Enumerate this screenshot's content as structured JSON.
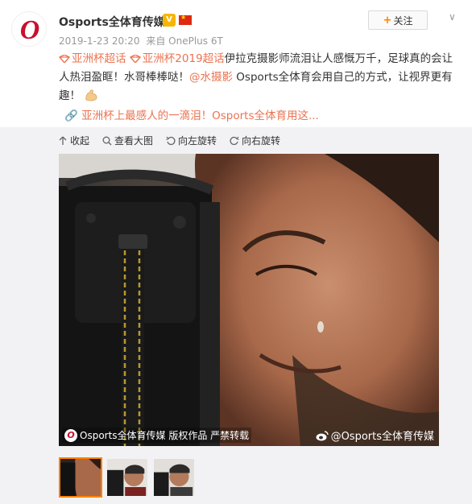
{
  "author": {
    "name": "Osports全体育传媒",
    "avatar_letter": "O",
    "badges": [
      "vip-badge-icon",
      "china-flag-icon"
    ]
  },
  "follow_button": {
    "plus": "+",
    "label": "关注"
  },
  "meta": {
    "timestamp": "2019-1-23 20:20",
    "from_prefix": "来自",
    "device": "OnePlus 6T"
  },
  "post": {
    "topic1": "亚洲杯超话",
    "topic2": "亚洲杯2019超话",
    "body1": "伊拉克摄影师流泪让人感慨万千，足球真的会让人热泪盈眶！水哥棒棒哒！",
    "mention": "@水摄影",
    "body2": " Osports全体育会用自己的方式，让视界更有趣！",
    "link_text": "亚洲杯上最感人的一滴泪！Osports全体育用这..."
  },
  "toolbar": {
    "collapse": "收起",
    "view_large": "查看大图",
    "rotate_left": "向左旋转",
    "rotate_right": "向右旋转"
  },
  "photo": {
    "watermark_left": "Osports全体育传媒  版权作品 严禁转载",
    "watermark_logo": "O",
    "watermark_right": "@Osports全体育传媒"
  },
  "colors": {
    "accent": "#ff8200",
    "link": "#eb7350",
    "meta": "#999999",
    "brand_red": "#c8102e"
  }
}
